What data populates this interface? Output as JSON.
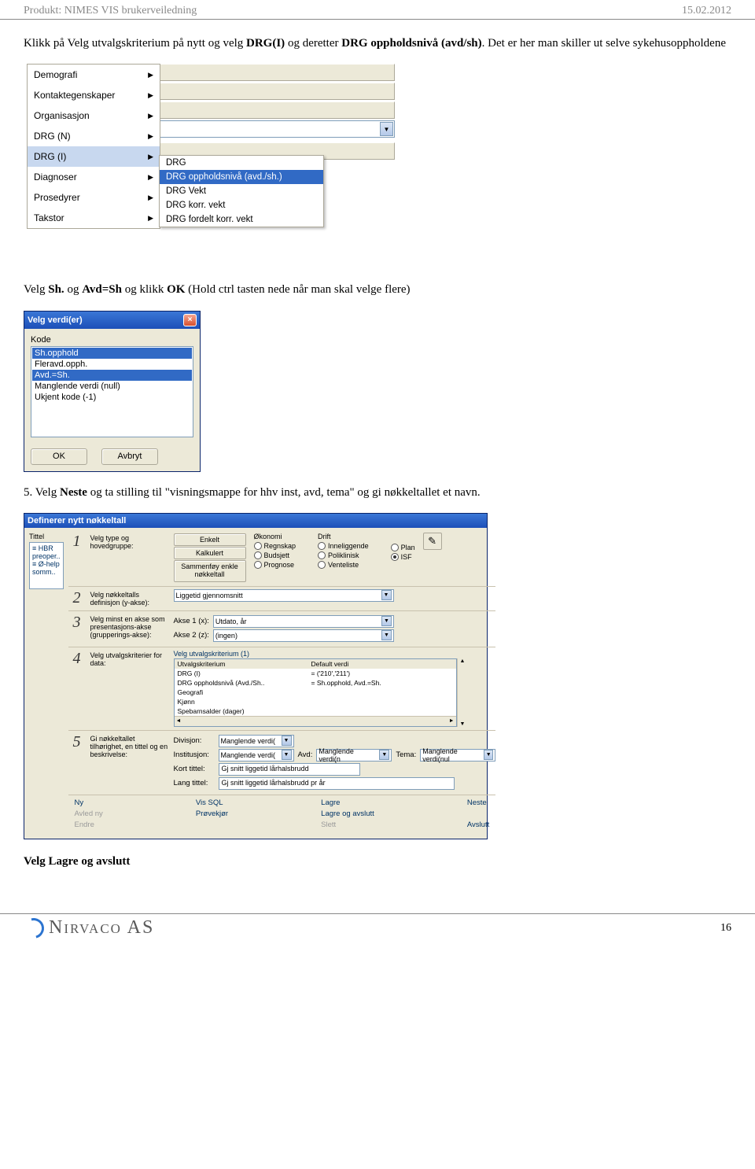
{
  "header": {
    "product": "Produkt: NIMES VIS brukerveiledning",
    "date": "15.02.2012"
  },
  "intro1_a": "Klikk på Velg utvalgskriterium på nytt og velg ",
  "intro1_b": "DRG(I)",
  "intro1_c": " og deretter ",
  "intro1_d": "DRG oppholdsnivå (avd/sh)",
  "intro1_e": ". Det er her man skiller ut selve sykehusoppholdene",
  "shot1": {
    "left": [
      "Demografi",
      "Kontaktegenskaper",
      "Organisasjon",
      "DRG (N)",
      "DRG (I)",
      "Diagnoser",
      "Prosedyrer",
      "Takstor"
    ],
    "selected_index": 4,
    "sub": [
      "DRG",
      "DRG oppholdsnivå (avd./sh.)",
      "DRG Vekt",
      "DRG korr. vekt",
      "DRG fordelt korr. vekt"
    ],
    "sub_selected_index": 1
  },
  "mid1_a": "Velg ",
  "mid1_b": "Sh.",
  "mid1_c": " og  ",
  "mid1_d": "Avd=Sh",
  "mid1_e": " og klikk ",
  "mid1_f": "OK",
  "mid1_g": " (Hold ctrl tasten nede når man skal velge flere)",
  "dlg": {
    "title": "Velg verdi(er)",
    "section_label": "Kode",
    "items": [
      "Sh.opphold",
      "Fleravd.opph.",
      "Avd.=Sh.",
      "Manglende verdi (null)",
      "Ukjent kode (-1)"
    ],
    "selected_indices": [
      0,
      2
    ],
    "ok": "OK",
    "cancel": "Avbryt"
  },
  "mid2_a": "5.  Velg ",
  "mid2_b": "Neste",
  "mid2_c": " og ta stilling til \"visningsmappe for hhv inst, avd, tema\" og gi nøkkeltallet et navn.",
  "wizard": {
    "title": "Definerer nytt nøkkeltall",
    "left_label": "Tittel",
    "left_rows": [
      "≡ HBR preoper..",
      "≡ Ø-help somm.."
    ],
    "step1": {
      "label": "Velg type og hovedgruppe:",
      "btn1": "Enkelt",
      "btn2": "Kalkulert",
      "btn3": "Sammenføy enkle nøkkeltall",
      "col1h": "Økonomi",
      "col1": [
        "Regnskap",
        "Budsjett",
        "Prognose"
      ],
      "col2h": "Drift",
      "col2": [
        "Inneliggende",
        "Poliklinisk",
        "Venteliste"
      ],
      "col3": [
        "Plan",
        "ISF"
      ],
      "checked": "ISF",
      "wand": "✎"
    },
    "step2": {
      "label": "Velg nøkkeltalls definisjon (y-akse):",
      "value": "Liggetid gjennomsnitt"
    },
    "step3": {
      "label": "Velg minst en akse som presentasjons-akse (grupperings-akse):",
      "ax1": "Akse 1 (x):",
      "ax1v": "Utdato, år",
      "ax2": "Akse 2 (z):",
      "ax2v": "(ingen)"
    },
    "step4": {
      "label": "Velg utvalgskriterier for data:",
      "header": "Velg utvalgskriterium (1)",
      "colA": "Utvalgskriterium",
      "colB": "Default verdi",
      "rows": [
        [
          "DRG (I)",
          "= ('210','211')"
        ],
        [
          "DRG oppholdsnivå (Avd./Sh..",
          "= Sh.opphold, Avd.=Sh."
        ],
        [
          "Geografi",
          ""
        ],
        [
          "Kjønn",
          ""
        ],
        [
          "Spebarnsalder (dager)",
          ""
        ]
      ]
    },
    "step5": {
      "label": "Gi nøkkeltallet tilhørighet, en tittel og en beskrivelse:",
      "div": "Divisjon:",
      "divv": "Manglende verdi(",
      "inst": "Institusjon:",
      "instv": "Manglende verdi(",
      "avd": "Avd:",
      "avdv": "Manglende verdi(n",
      "tema": "Tema:",
      "temav": "Manglende verdi(nul",
      "kort": "Kort tittel:",
      "kortv": "Gj snitt liggetid lårhalsbrudd",
      "lang": "Lang tittel:",
      "langv": "Gj snitt liggetid lårhalsbrudd pr år"
    },
    "bottom": {
      "ny": "Ny",
      "avledny": "Avled ny",
      "endre": "Endre",
      "vissql": "Vis SQL",
      "provekjor": "Prøvekjør",
      "lagre": "Lagre",
      "lagreog": "Lagre og avslutt",
      "slett": "Slett",
      "neste": "Neste",
      "avslutt": "Avslutt"
    }
  },
  "end": "Velg Lagre og avslutt",
  "footer": {
    "brand": "Nirvaco AS",
    "page": "16"
  }
}
